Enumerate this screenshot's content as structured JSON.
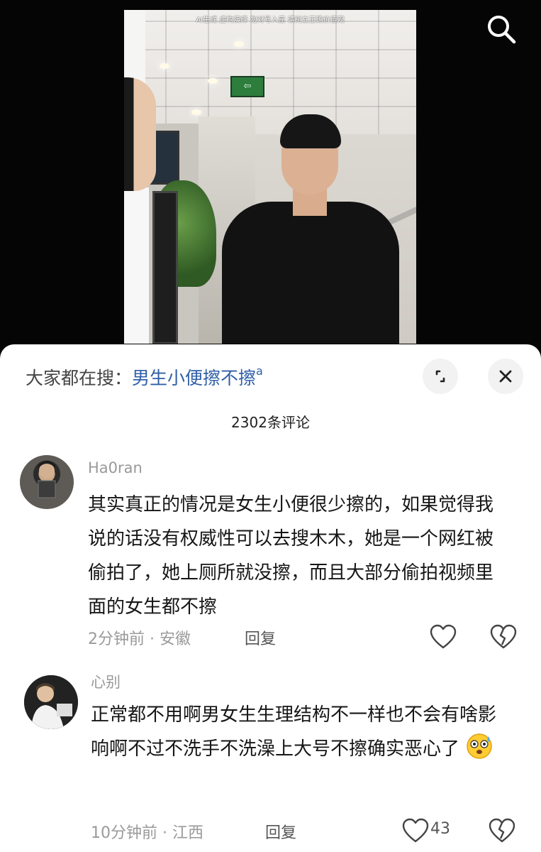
{
  "video": {
    "watermark": "AI生成 虚构演绎 勿对号入座 请树立正确价值观",
    "exit_sign": "⇦"
  },
  "search_icon": "search-icon",
  "sheet": {
    "hot_search_prefix": "大家都在搜：",
    "hot_search_term": "男生小便擦不擦",
    "comment_count": "2302条评论"
  },
  "comments": [
    {
      "user": "Ha0ran",
      "text": "其实真正的情况是女生小便很少擦的，如果觉得我说的话没有权威性可以去搜木木，她是一个网红被偷拍了，她上厕所就没擦，而且大部分偷拍视频里面的女生都不擦",
      "time": "2分钟前",
      "location": "安徽",
      "reply": "回复",
      "likes": ""
    },
    {
      "user": "心别",
      "text": "正常都不用啊男女生生理结构不一样也不会有啥影响啊不过不洗手不洗澡上大号不擦确实恶心了",
      "time": "10分钟前",
      "location": "江西",
      "reply": "回复",
      "likes": "43"
    }
  ],
  "colors": {
    "accent_link": "#2f5fa8",
    "meta_gray": "#9a9a9a",
    "background_dark": "#000000"
  }
}
